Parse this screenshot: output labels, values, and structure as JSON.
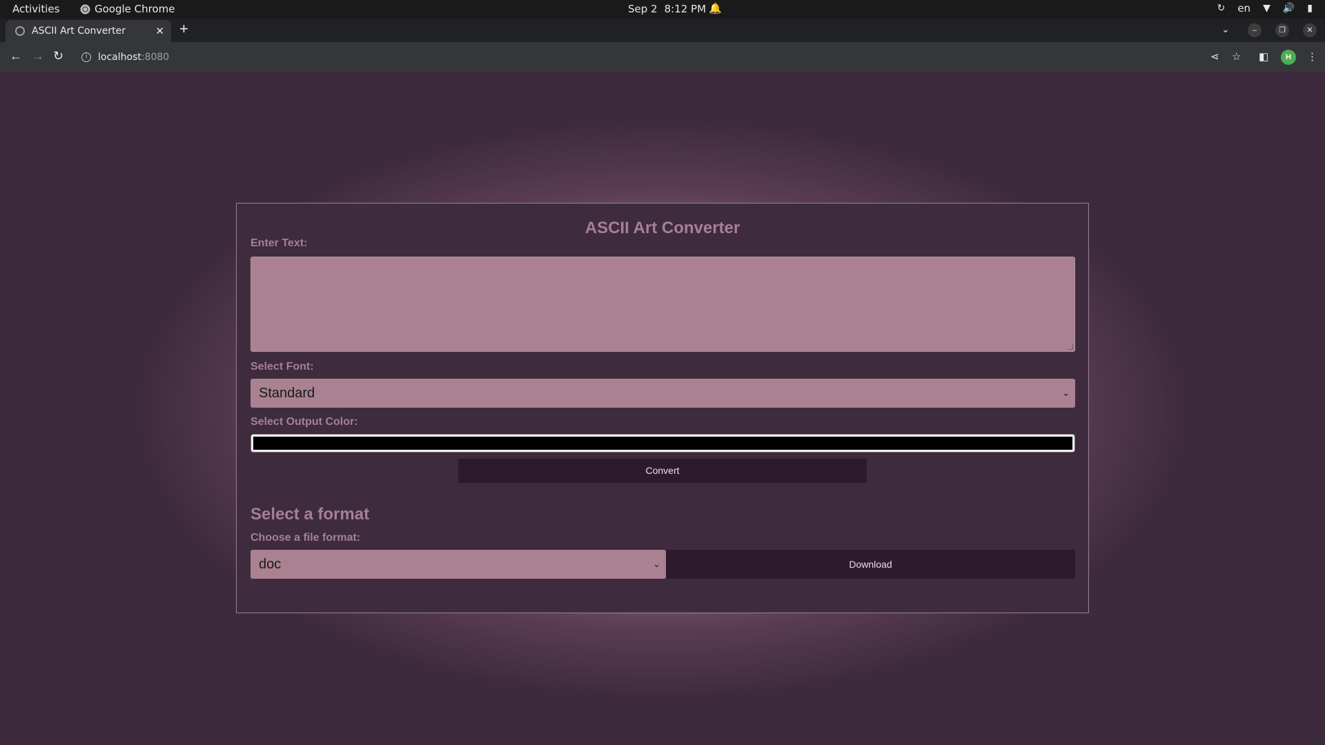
{
  "os": {
    "activities": "Activities",
    "app_name": "Google Chrome",
    "date": "Sep 2",
    "time": "8:12 PM",
    "language": "en"
  },
  "browser": {
    "tab_title": "ASCII Art Converter",
    "url_host": "localhost",
    "url_port": ":8080",
    "avatar_letter": "H"
  },
  "page": {
    "title": "ASCII Art Converter",
    "text_label": "Enter Text:",
    "text_value": "",
    "font_label": "Select Font:",
    "font_selected": "Standard",
    "color_label": "Select Output Color:",
    "color_value": "#000000",
    "convert_label": "Convert",
    "format_heading": "Select a format",
    "file_format_label": "Choose a file format:",
    "file_format_selected": "doc",
    "download_label": "Download"
  }
}
